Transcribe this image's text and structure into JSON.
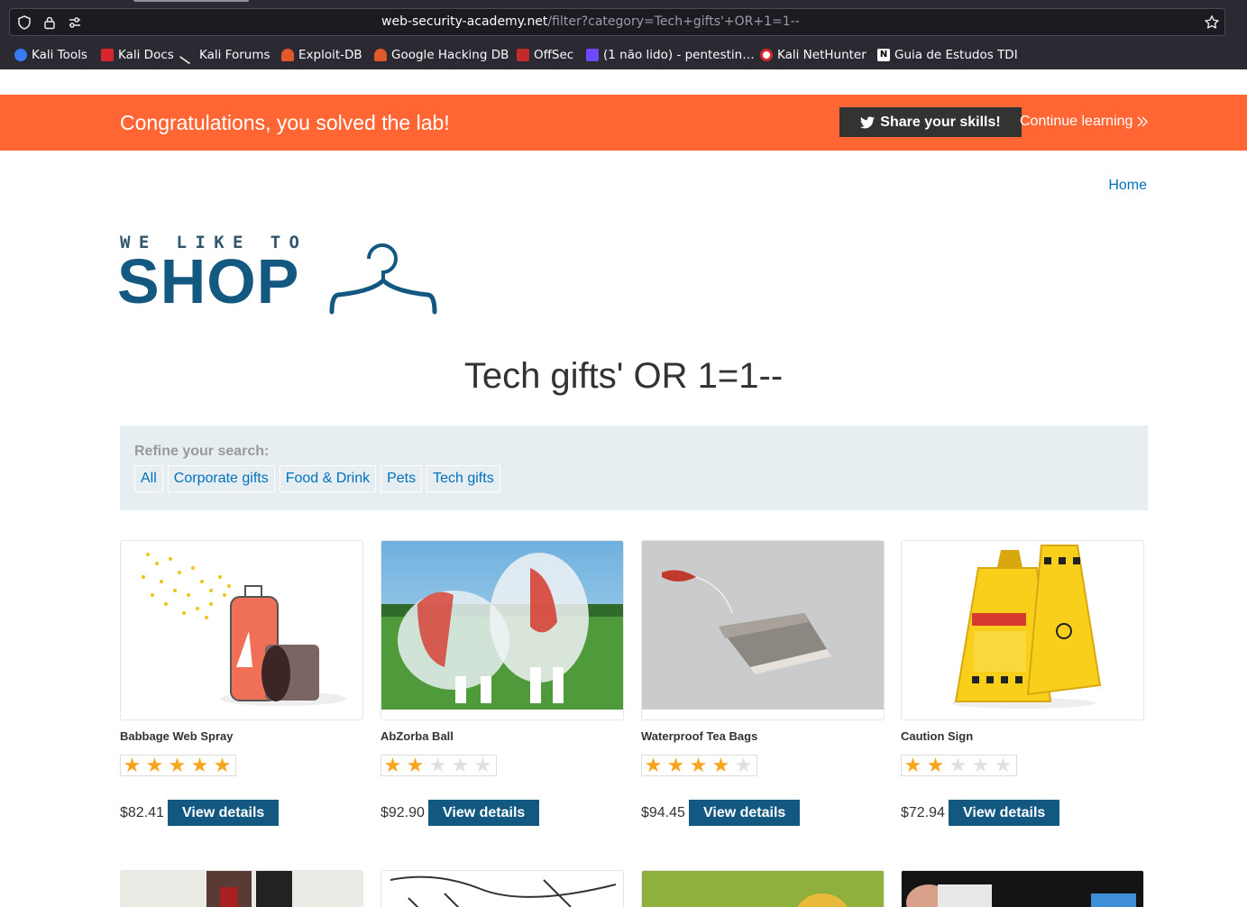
{
  "browser": {
    "url_host": "web-security-academy.net",
    "url_path": "/filter?category=Tech+gifts'+OR+1=1--",
    "bookmarks": [
      {
        "label": "Kali Tools"
      },
      {
        "label": "Kali Docs"
      },
      {
        "label": "Kali Forums"
      },
      {
        "label": "Exploit-DB"
      },
      {
        "label": "Google Hacking DB"
      },
      {
        "label": "OffSec"
      },
      {
        "label": "(1 não lido) - pentestin…"
      },
      {
        "label": "Kali NetHunter"
      },
      {
        "label": "Guia de Estudos TDI"
      }
    ]
  },
  "banner": {
    "message": "Congratulations, you solved the lab!",
    "share_label": "Share your skills!",
    "continue_label": "Continue learning"
  },
  "nav": {
    "home": "Home"
  },
  "logo": {
    "top": "WE LIKE TO",
    "main": "SHOP"
  },
  "category_title": "Tech gifts' OR 1=1--",
  "filter": {
    "label": "Refine your search:",
    "categories": [
      "All",
      "Corporate gifts",
      "Food & Drink",
      "Pets",
      "Tech gifts"
    ]
  },
  "products": [
    {
      "name": "Babbage Web Spray",
      "rating": 5,
      "price": "$82.41",
      "button": "View details"
    },
    {
      "name": "AbZorba Ball",
      "rating": 2,
      "price": "$92.90",
      "button": "View details"
    },
    {
      "name": "Waterproof Tea Bags",
      "rating": 4,
      "price": "$94.45",
      "button": "View details"
    },
    {
      "name": "Caution Sign",
      "rating": 2,
      "price": "$72.94",
      "button": "View details"
    }
  ],
  "colors": {
    "banner": "#ff6633",
    "brand_blue": "#125881",
    "link": "#0071bc",
    "star": "#f7a41d"
  }
}
